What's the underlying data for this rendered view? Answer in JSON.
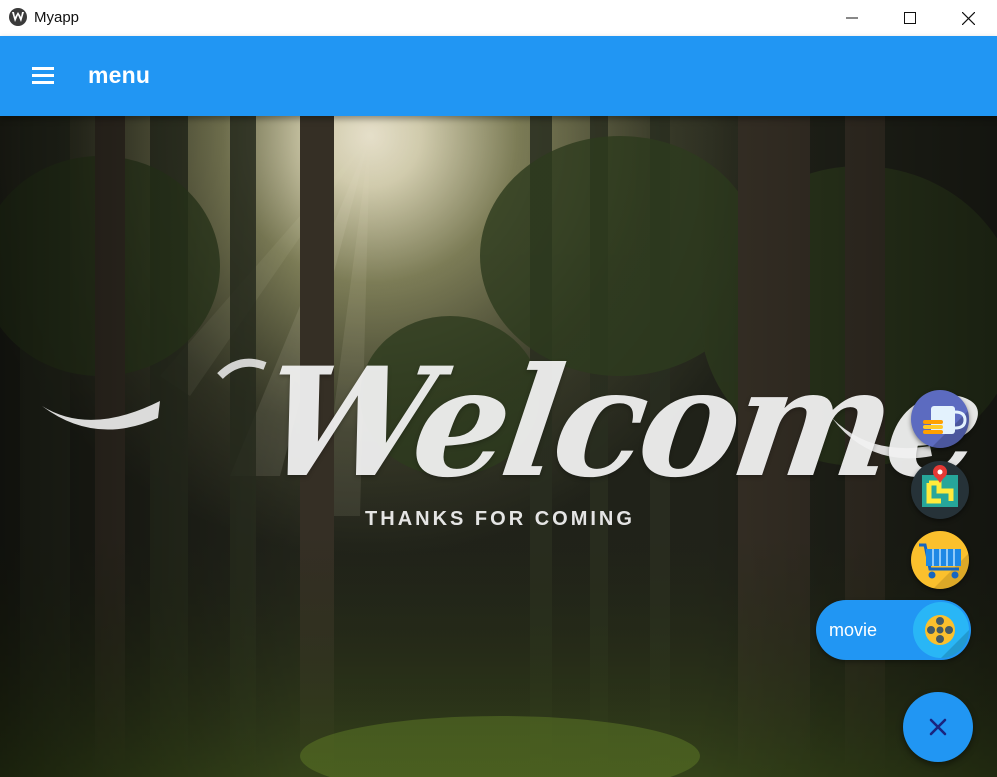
{
  "window": {
    "title": "Myapp"
  },
  "appbar": {
    "title": "menu",
    "menu_icon": "hamburger-icon"
  },
  "banner": {
    "headline": "Welcome",
    "subheadline": "THANKS FOR COMING"
  },
  "speed_dial": {
    "items": [
      {
        "icon": "coffee-icon"
      },
      {
        "icon": "map-icon"
      },
      {
        "icon": "cart-icon"
      },
      {
        "icon": "movie-reel-icon",
        "label": "movie"
      }
    ],
    "toggle_icon": "close-icon"
  },
  "colors": {
    "primary": "#2196f3",
    "titlebar": "#ffffff"
  }
}
